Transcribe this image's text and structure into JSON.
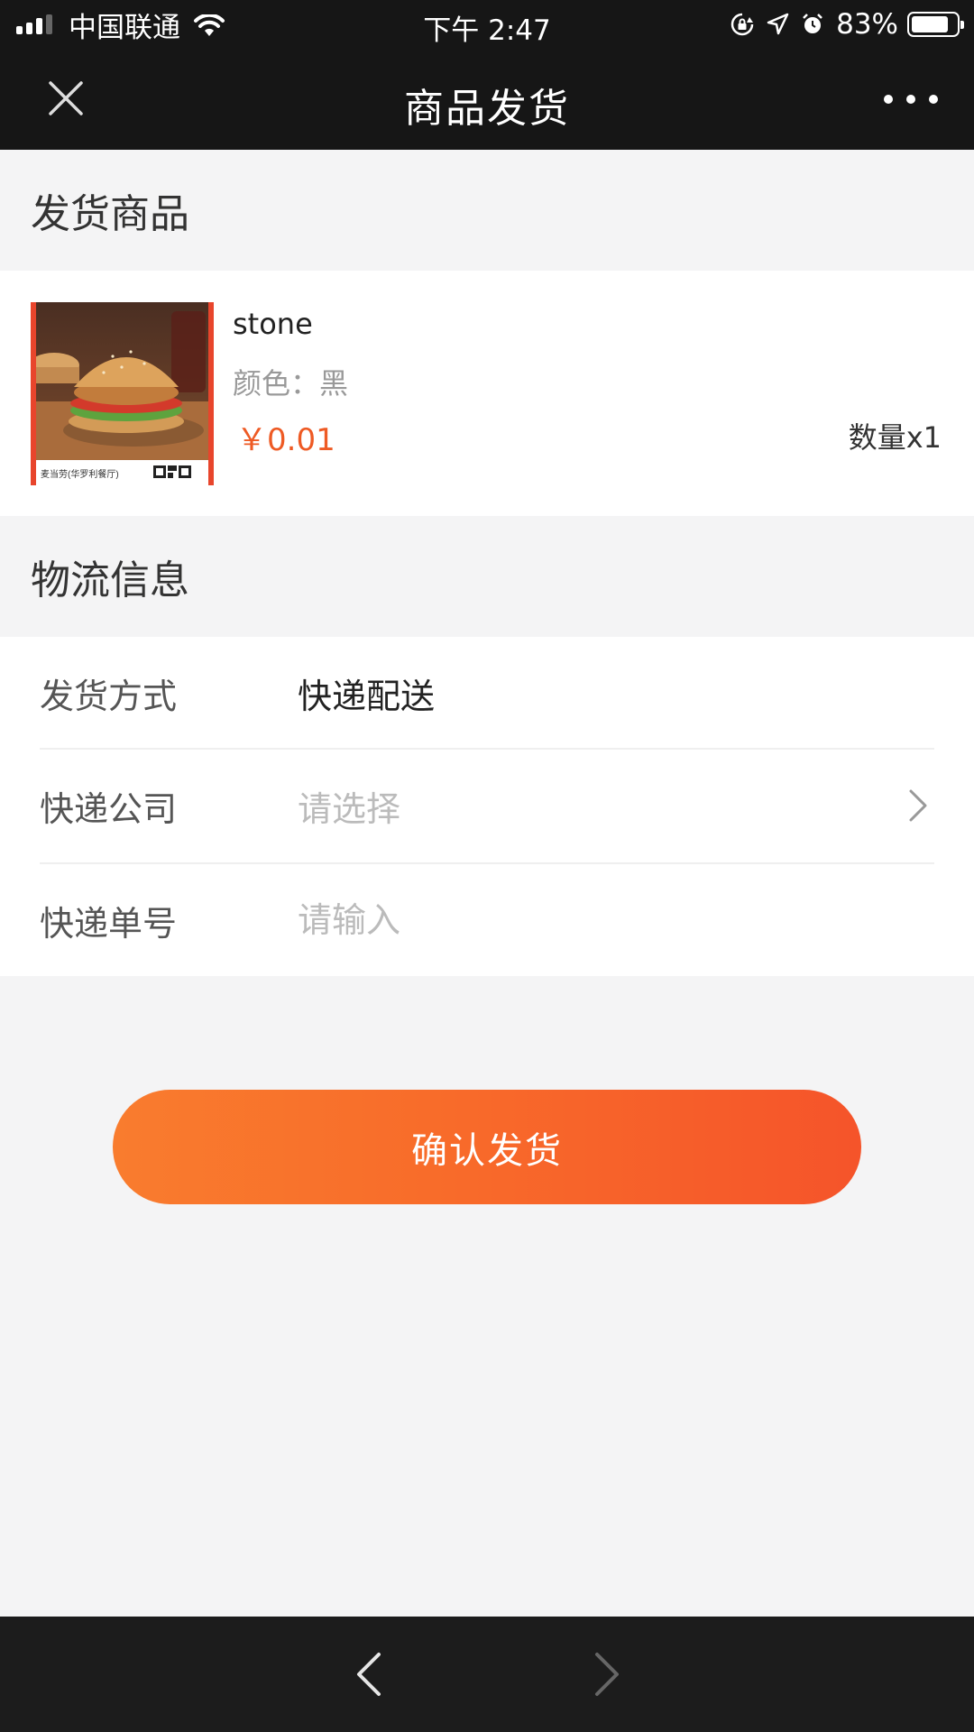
{
  "status_bar": {
    "carrier": "中国联通",
    "time": "下午 2:47",
    "battery_percent": "83%",
    "battery_level": 0.83,
    "icons": [
      "signal-icon",
      "wifi-icon",
      "rotation-lock-icon",
      "location-icon",
      "alarm-icon",
      "battery-icon"
    ]
  },
  "nav": {
    "title": "商品发货",
    "icons": [
      "close-icon",
      "more-icon"
    ]
  },
  "goods_section": {
    "header": "发货商品",
    "item": {
      "name": "stone",
      "spec": "颜色：黑",
      "price": "￥0.01",
      "quantity": "数量x1",
      "image_caption": "麦当劳(华罗利餐厅)"
    }
  },
  "logistics_section": {
    "header": "物流信息",
    "rows": [
      {
        "label": "发货方式",
        "value": "快递配送"
      },
      {
        "label": "快递公司",
        "placeholder": "请选择"
      },
      {
        "label": "快递单号",
        "placeholder": "请输入"
      }
    ]
  },
  "confirm_label": "确认发货",
  "colors": {
    "accent": "#f86b2a",
    "price": "#ee5a24",
    "bar_background": "#161616",
    "page_background": "#f4f4f5"
  },
  "bottom_bar": {
    "icons": [
      "back-arrow-icon",
      "forward-arrow-icon"
    ]
  }
}
